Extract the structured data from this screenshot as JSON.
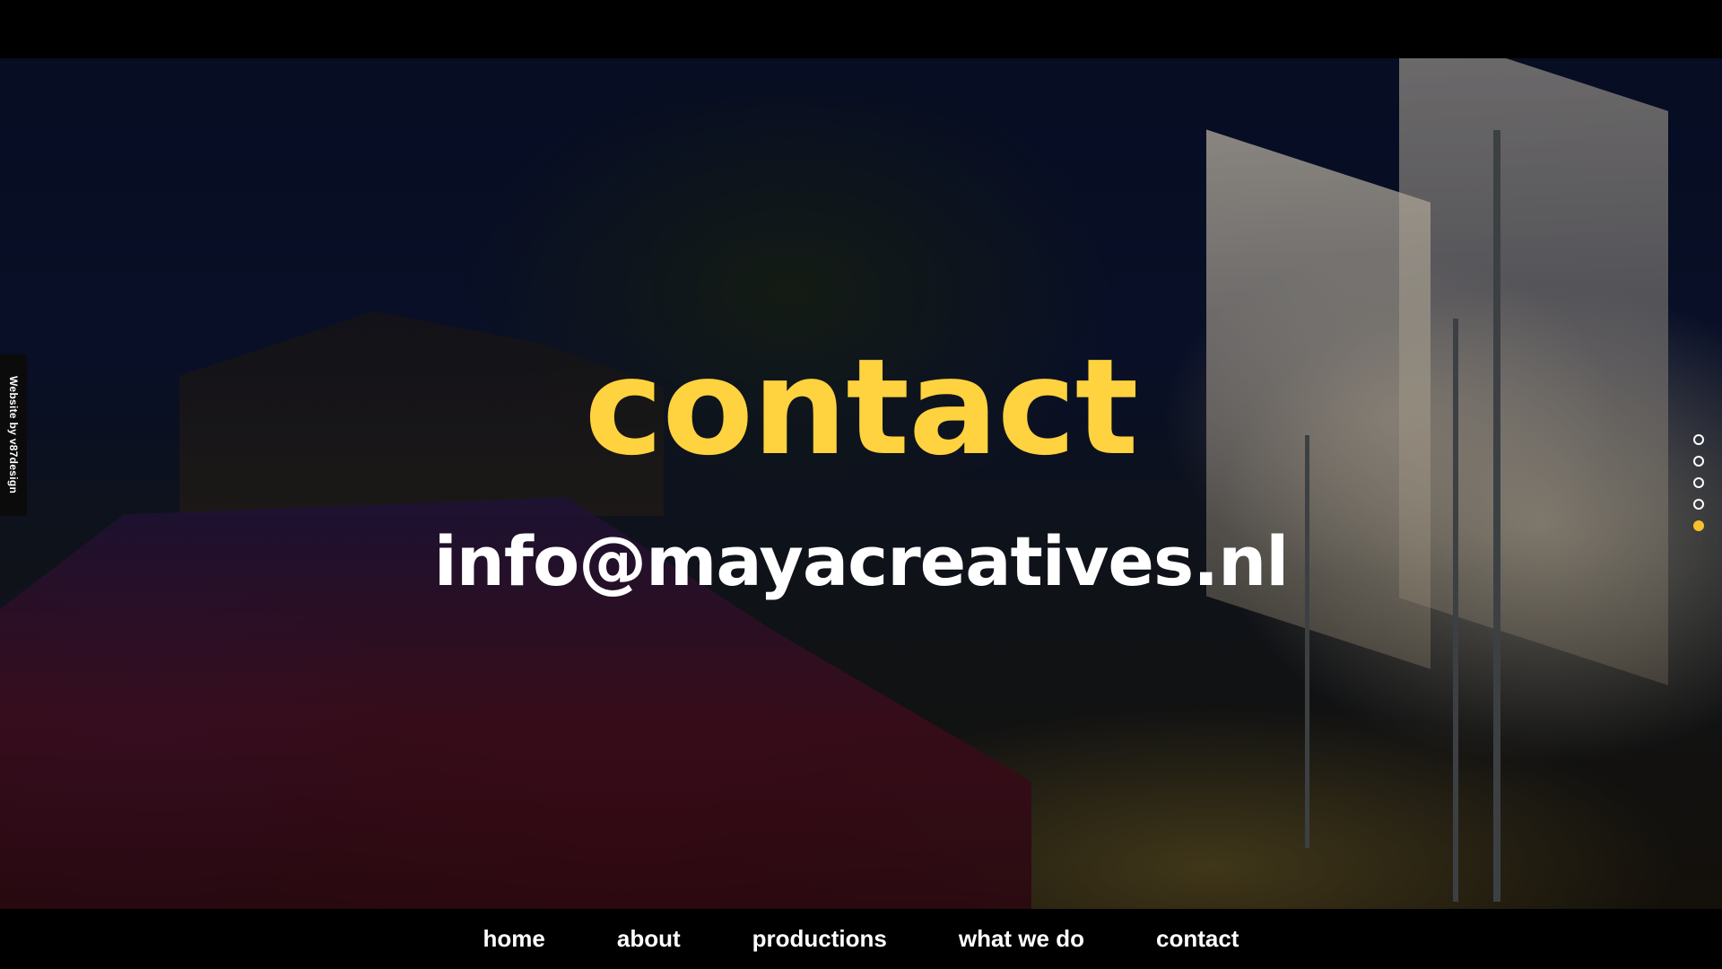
{
  "credit": "Website by v87design",
  "page": {
    "title": "contact",
    "email": "info@mayacreatives.nl"
  },
  "slider": {
    "total": 5,
    "active_index": 4
  },
  "nav": {
    "items": [
      {
        "label": "home"
      },
      {
        "label": "about"
      },
      {
        "label": "productions"
      },
      {
        "label": "what we do"
      },
      {
        "label": "contact"
      }
    ]
  },
  "colors": {
    "accent": "#ffd23f",
    "text": "#ffffff",
    "background": "#000000"
  }
}
